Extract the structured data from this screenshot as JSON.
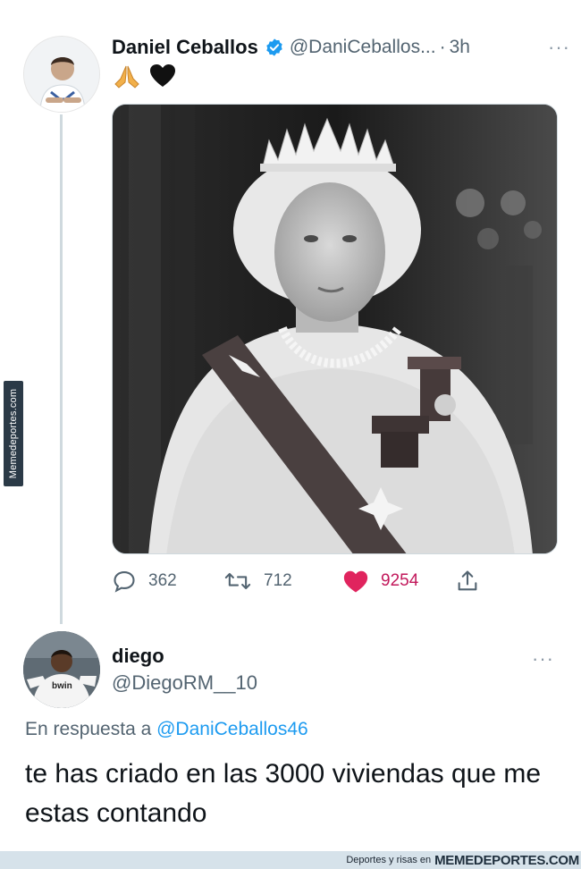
{
  "tweet": {
    "author_name": "Daniel Ceballos",
    "author_handle": "@DaniCeballos...",
    "separator": "·",
    "time": "3h",
    "emojis": [
      "🙏",
      "🖤"
    ],
    "more_label": "···",
    "stats": {
      "replies": "362",
      "retweets": "712",
      "likes": "9254"
    },
    "icons": [
      "verified-badge-icon",
      "reply-icon",
      "retweet-icon",
      "heart-icon",
      "share-icon",
      "more-icon"
    ],
    "accent_color": "#1d9bf0",
    "like_color": "#e0245e"
  },
  "reply": {
    "author_name": "diego",
    "author_handle": "@DiegoRM__10",
    "more_label": "···",
    "replying_prefix": "En respuesta a",
    "replying_to": "@DaniCeballos46",
    "text": "te has criado en las 3000 viviendas que me estas contando"
  },
  "watermark": {
    "side_text": "Memedeportes.com",
    "footer_text": "Deportes y risas en",
    "footer_brand": "MEMEDEPORTES.COM"
  }
}
